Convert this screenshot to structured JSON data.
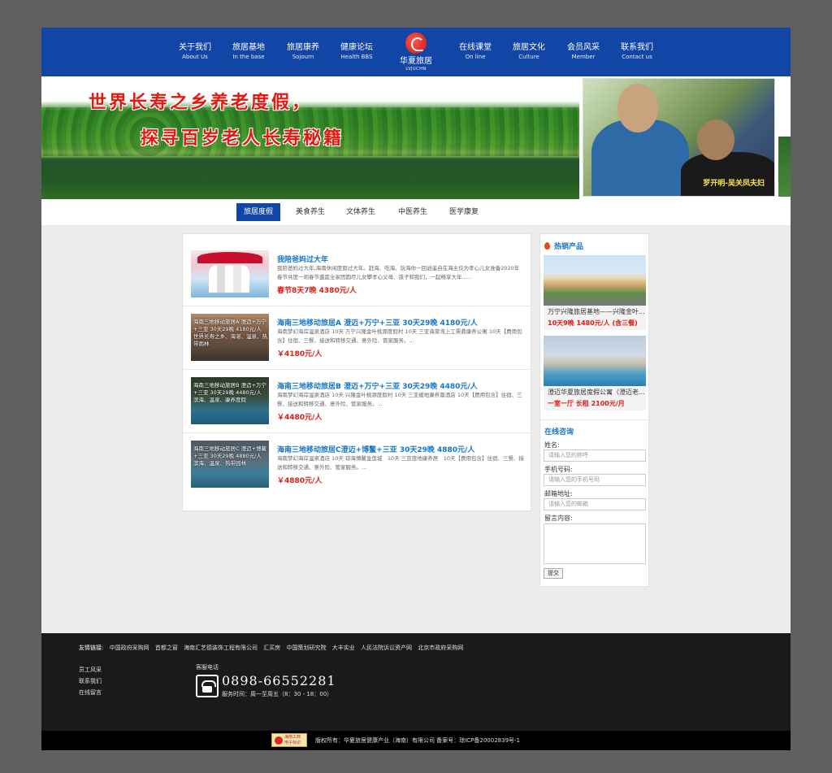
{
  "nav": {
    "left": [
      {
        "cn": "关于我们",
        "en": "About Us"
      },
      {
        "cn": "旅居基地",
        "en": "In the base"
      },
      {
        "cn": "旅居康养",
        "en": "Sojourn"
      },
      {
        "cn": "健康论坛",
        "en": "Health BBS"
      }
    ],
    "right": [
      {
        "cn": "在线课堂",
        "en": "On line"
      },
      {
        "cn": "旅居文化",
        "en": "Culture"
      },
      {
        "cn": "会员风采",
        "en": "Member"
      },
      {
        "cn": "联系我们",
        "en": "Contact us"
      }
    ],
    "logo": {
      "cn": "华夏旅居",
      "en": "LVJUCHN"
    }
  },
  "banner": {
    "line1": "世界长寿之乡养老度假，",
    "line2": "探寻百岁老人长寿秘籍",
    "photo_caption": "罗开明-吴关凤夫妇"
  },
  "tabs": [
    "旅居度假",
    "美食养生",
    "文体养生",
    "中医养生",
    "医学康复"
  ],
  "list": [
    {
      "title": "我陪爸妈过大年",
      "desc": "我陪爸妈过大年,海南休闲度假过大年。赶海、吃海、玩海你一回逍遥自在海主仅为孝心儿女准备2020年春节共度一闹春节盛筵全家团圆尽儿女攀孝心父母、孩子和我们，一起畅享大年......",
      "price": "春节8天7晚 4380元/人",
      "overlay": ""
    },
    {
      "title": "海南三地移动旅居A 澄迈+万宁+三亚 30天29晚 4180元/人",
      "desc": "海南梦幻海岸温泉酒店 10天 万宁兴隆金叶桃源度假村 10天 三亚海棠湾上工票鼎康养公寓 10天【费用包含】住宿、三餐、接送和转移交通、意外险、管家服务。...",
      "price": "￥4180元/人",
      "overlay": "海南三地移动旅居A 澄迈+万宁+三亚 30天29晚 4180元/人 世界长寿之乡、海湛、温泉、热带雨林"
    },
    {
      "title": "海南三地移动旅居B 澄迈+万宁+三亚 30天29晚 4480元/人",
      "desc": "海南梦幻海岸温泉酒店 10天 兴隆金叶桃源度假村 10天 三亚缓地康养篇酒店 10天【费用包含】住宿、三餐、接送和转移交通、意外险、管家服务。...",
      "price": "￥4480元/人",
      "overlay": "海南三地移动旅居B 澄迈+万宁+三亚 30天29晚 4480元/人 滨海、温泉、康养度假"
    },
    {
      "title": "海南三地移动旅居C澄迈+博鳌+三亚 30天29晚 4880元/人",
      "desc": "海南梦幻海岸温泉酒店 10天 琼海博鳌金莲城　10天 三亚旅地康养居　10天【费用包含】住宿、三餐、接送和转移交通、意外险、管家服务。...",
      "price": "￥4880元/人",
      "overlay": "海南三地移动旅居C 澄迈+博鳌+三亚 30天29晚 4880元/人 滨海、温泉、热带园林"
    }
  ],
  "sidebar": {
    "hot_title": "热销产品",
    "products": [
      {
        "name": "万宁兴隆旅居基地——兴隆金叶...",
        "price": "10天9晚 1480元/人 (含三餐)"
      },
      {
        "name": "澄迈华夏旅居度假公寓（澄迈老...",
        "price": "一室一厅 长租 2100元/月"
      }
    ],
    "consult_title": "在线咨询",
    "form": {
      "name_label": "姓名:",
      "name_ph": "请输入您的称呼",
      "phone_label": "手机号码:",
      "phone_ph": "请输入您的手机号码",
      "email_label": "邮箱地址:",
      "email_ph": "请输入您的邮箱",
      "msg_label": "留言内容:",
      "submit": "提交"
    }
  },
  "footer": {
    "links_label": "友情链接:",
    "links": [
      "中国政府采购网",
      "首都之窗",
      "海南汇艺德装饰工程有限公司",
      "汇买房",
      "中国策划研究院",
      "大丰实业",
      "人民法院诉讼资产网",
      "北京市政府采购网"
    ],
    "nav": [
      "员工风采",
      "联系我们",
      "在线留言"
    ],
    "hotline_label": "客服电话",
    "hotline": "0898-66552281",
    "hours": "服务时间：周一至周五（8：30 - 18：00）",
    "badge": [
      "海南工商",
      "电子标识"
    ],
    "copyright": "版权所有：华夏旅居健康产业（海南）有限公司 备案号：琼ICP备20002839号-1"
  },
  "colors": {
    "brand_blue": "#1146a6",
    "link_blue": "#1576c5",
    "price_red": "#e01b12",
    "footer_bg": "#1a1a1a"
  }
}
